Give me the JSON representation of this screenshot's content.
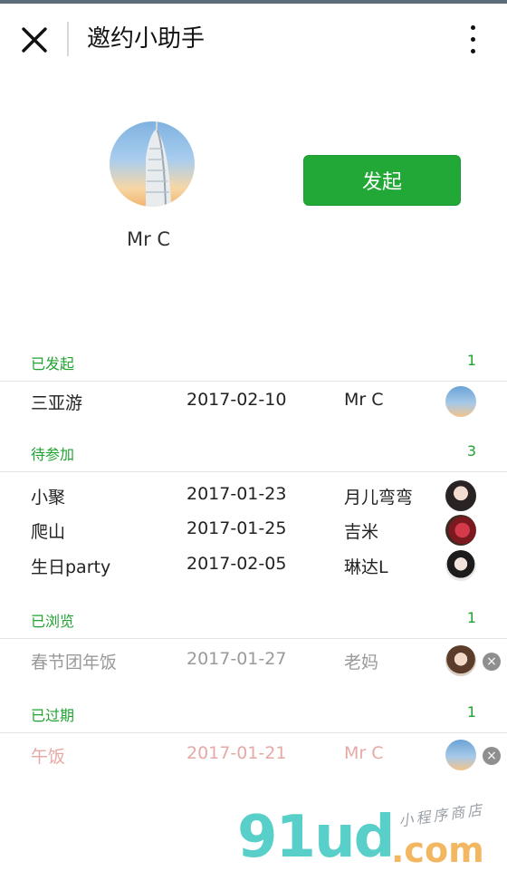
{
  "nav": {
    "title": "邀约小助手",
    "close_icon": "close-icon",
    "more_icon": "more-vertical-icon"
  },
  "profile": {
    "name": "Mr C",
    "avatar": "tower-photo-avatar",
    "launch_label": "发起"
  },
  "colors": {
    "accent_green": "#22a836",
    "section_green": "#21a331",
    "viewed_gray": "#9a9a9a",
    "expired_pink": "#e6a9a6"
  },
  "sections": [
    {
      "title": "已发起",
      "count": "1",
      "rows": [
        {
          "name": "三亚游",
          "date": "2017-02-10",
          "user": "Mr C",
          "avatar": "tower-photo-avatar"
        }
      ]
    },
    {
      "title": "待参加",
      "count": "3",
      "rows": [
        {
          "name": "小聚",
          "date": "2017-01-23",
          "user": "月儿弯弯",
          "avatar": "user-photo-avatar"
        },
        {
          "name": "爬山",
          "date": "2017-01-25",
          "user": "吉米",
          "avatar": "user-photo-avatar"
        },
        {
          "name": "生日party",
          "date": "2017-02-05",
          "user": "琳达L",
          "avatar": "user-photo-avatar"
        }
      ]
    },
    {
      "title": "已浏览",
      "count": "1",
      "rows": [
        {
          "name": "春节团年饭",
          "date": "2017-01-27",
          "user": "老妈",
          "avatar": "user-photo-avatar",
          "delete_icon": "delete-circle-icon"
        }
      ]
    },
    {
      "title": "已过期",
      "count": "1",
      "rows": [
        {
          "name": "午饭",
          "date": "2017-01-21",
          "user": "Mr C",
          "avatar": "tower-photo-avatar",
          "delete_icon": "delete-circle-icon"
        }
      ]
    }
  ],
  "watermark": {
    "brand": "91ud",
    "suffix": ".com",
    "tagline": "小程序商店"
  }
}
